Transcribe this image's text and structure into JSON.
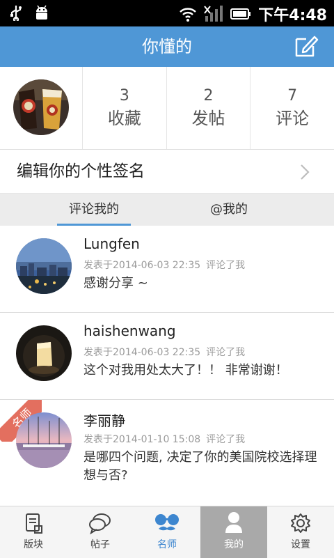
{
  "statusbar": {
    "time": "下午4:48"
  },
  "appbar": {
    "title": "你懂的"
  },
  "profile": {
    "stats": [
      {
        "num": "3",
        "label": "收藏"
      },
      {
        "num": "2",
        "label": "发帖"
      },
      {
        "num": "7",
        "label": "评论"
      }
    ]
  },
  "signature": {
    "text": "编辑你的个性签名"
  },
  "tabs": [
    {
      "label": "评论我的"
    },
    {
      "label": "@我的"
    }
  ],
  "comments": [
    {
      "name": "Lungfen",
      "date": "发表于2014-06-03 22:35",
      "action": "评论了我",
      "body": "感谢分享 ~",
      "badge": ""
    },
    {
      "name": "haishenwang",
      "date": "发表于2014-06-03 22:35",
      "action": "评论了我",
      "body": "这个对我用处太大了！！ 非常谢谢！",
      "badge": ""
    },
    {
      "name": "李丽静",
      "date": "发表于2014-01-10 15:08",
      "action": "评论了我",
      "body": "是哪四个问题, 决定了你的美国院校选择理想与否?",
      "badge": "名师"
    }
  ],
  "bottomnav": [
    {
      "label": "版块",
      "icon": "forum-icon"
    },
    {
      "label": "帖子",
      "icon": "chat-bubble-icon"
    },
    {
      "label": "名师",
      "icon": "glasses-mustache-icon"
    },
    {
      "label": "我的",
      "icon": "person-icon"
    },
    {
      "label": "设置",
      "icon": "gear-icon"
    }
  ],
  "colors": {
    "primary": "#4f97d6",
    "ribbon": "#e36f5f",
    "activeNav": "#a9a9a9"
  }
}
